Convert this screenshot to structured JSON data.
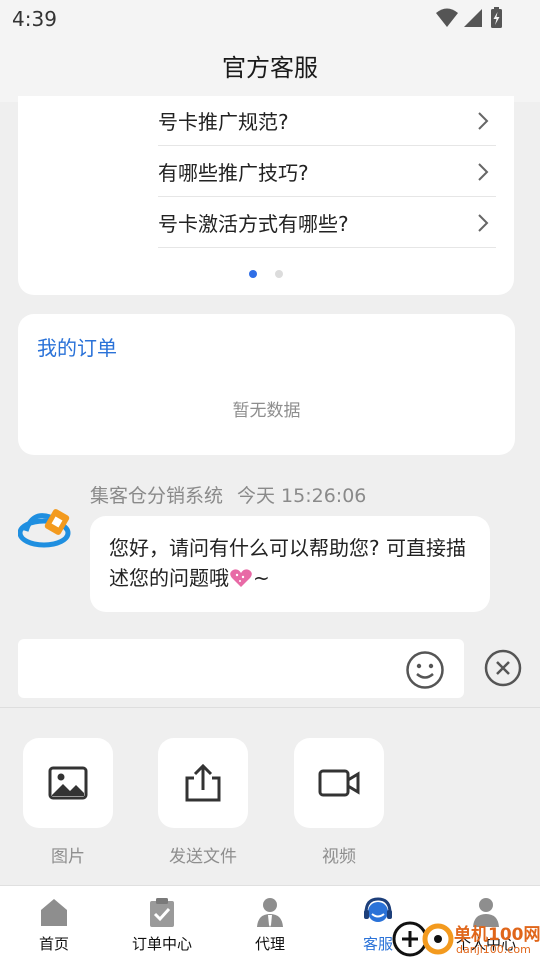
{
  "status_bar": {
    "time": "4:39"
  },
  "header": {
    "title": "官方客服"
  },
  "faq": {
    "items": [
      {
        "question": "号卡推广规范?"
      },
      {
        "question": "有哪些推广技巧?"
      },
      {
        "question": "号卡激活方式有哪些?"
      }
    ],
    "page_count": 2,
    "active_page": 1
  },
  "orders": {
    "title": "我的订单",
    "empty_text": "暂无数据"
  },
  "message": {
    "sender": "集客仓分销系统",
    "time": "今天 15:26:06",
    "text": "您好，请问有什么可以帮助您? 可直接描述您的问题哦",
    "tail": "~"
  },
  "input": {
    "placeholder": ""
  },
  "tools": [
    {
      "label": "图片",
      "icon": "image-icon"
    },
    {
      "label": "发送文件",
      "icon": "share-upload-icon"
    },
    {
      "label": "视频",
      "icon": "video-camera-icon"
    }
  ],
  "tabs": [
    {
      "label": "首页",
      "icon": "home-icon"
    },
    {
      "label": "订单中心",
      "icon": "clipboard-check-icon"
    },
    {
      "label": "代理",
      "icon": "agent-person-icon"
    },
    {
      "label": "客服",
      "icon": "headset-service-icon",
      "active": true
    },
    {
      "label": "个人中心",
      "icon": "user-icon"
    }
  ],
  "watermark": {
    "line1": "单机100网",
    "line2": "danji100.com"
  },
  "colors": {
    "accent": "#2a72d8",
    "page_bg": "#efefef",
    "card_bg": "#ffffff",
    "muted_text": "#8e8e8e"
  }
}
